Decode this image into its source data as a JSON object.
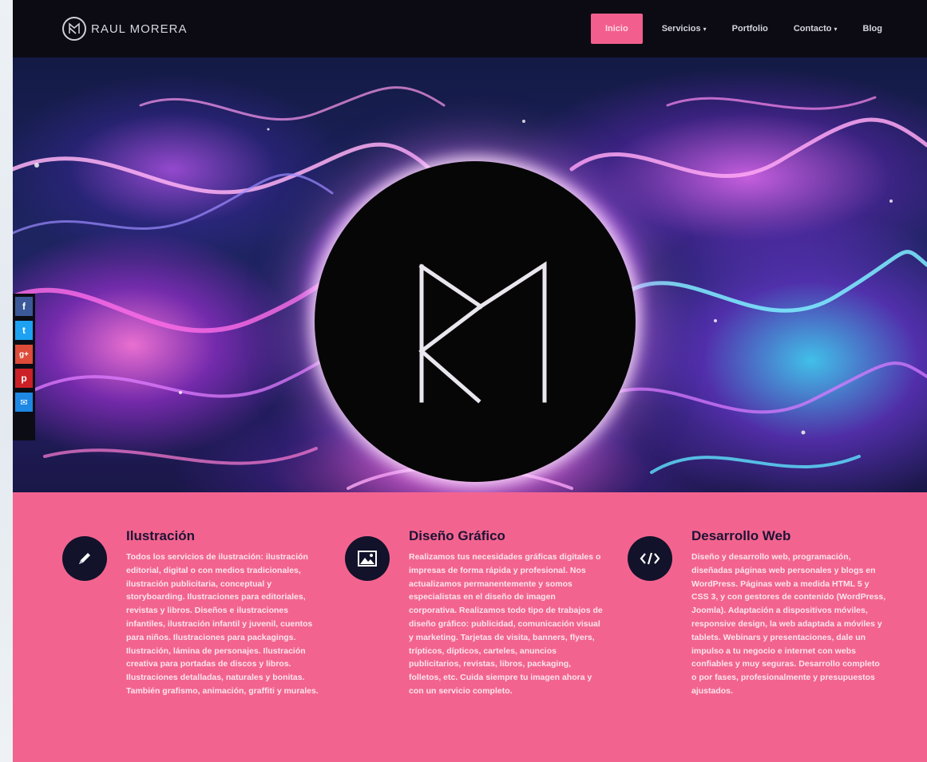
{
  "brand": {
    "logo_text": "RAUL MORERA",
    "logo_mark": "RM"
  },
  "nav": {
    "items": [
      {
        "label": "Inicio",
        "active": true,
        "has_dropdown": false
      },
      {
        "label": "Servicios",
        "active": false,
        "has_dropdown": true
      },
      {
        "label": "Portfolio",
        "active": false,
        "has_dropdown": false
      },
      {
        "label": "Contacto",
        "active": false,
        "has_dropdown": true
      },
      {
        "label": "Blog",
        "active": false,
        "has_dropdown": false
      }
    ]
  },
  "hero": {
    "monogram": "RM"
  },
  "social": {
    "buttons": [
      {
        "name": "facebook-icon",
        "glyph": "f",
        "color": "#3b5998"
      },
      {
        "name": "twitter-icon",
        "glyph": "t",
        "color": "#1da1f2"
      },
      {
        "name": "google-plus-icon",
        "glyph": "g+",
        "color": "#dd4b39"
      },
      {
        "name": "pinterest-icon",
        "glyph": "p",
        "color": "#cb2027"
      },
      {
        "name": "share-icon",
        "glyph": "✉",
        "color": "#1e88e5"
      }
    ]
  },
  "services": [
    {
      "title": "Ilustración",
      "icon": "pencil-icon",
      "text": "Todos los servicios de ilustración: ilustración editorial, digital o con medios tradicionales, ilustración publicitaria, conceptual y storyboarding. Ilustraciones para editoriales, revistas y libros. Diseños e ilustraciones infantiles, ilustración infantil y juvenil, cuentos para niños. Ilustraciones para packagings. Ilustración, lámina de personajes. Ilustración creativa para portadas de discos y libros. Ilustraciones detalladas, naturales y bonitas. También grafismo, animación, graffiti y murales."
    },
    {
      "title": "Diseño Gráfico",
      "icon": "image-icon",
      "text": "Realizamos tus necesidades gráficas digitales o impresas de forma rápida y profesional. Nos actualizamos permanentemente y somos especialistas en el diseño de imagen corporativa. Realizamos todo tipo de trabajos de diseño gráfico: publicidad, comunicación visual y marketing. Tarjetas de visita, banners, flyers, trípticos, dípticos, carteles, anuncios publicitarios, revistas, libros, packaging, folletos, etc. Cuida siempre tu imagen ahora y con un servicio completo."
    },
    {
      "title": "Desarrollo Web",
      "icon": "code-icon",
      "text": "Diseño y desarrollo web, programación, diseñadas páginas web personales y blogs en WordPress. Páginas web a medida HTML 5 y CSS 3, y con gestores de contenido (WordPress, Joomla). Adaptación a dispositivos móviles, responsive design, la web adaptada a móviles y tablets. Webinars y presentaciones, dale un impulso a tu negocio e internet con webs confiables y muy seguras. Desarrollo completo o por fases, profesionalmente y presupuestos ajustados."
    }
  ]
}
